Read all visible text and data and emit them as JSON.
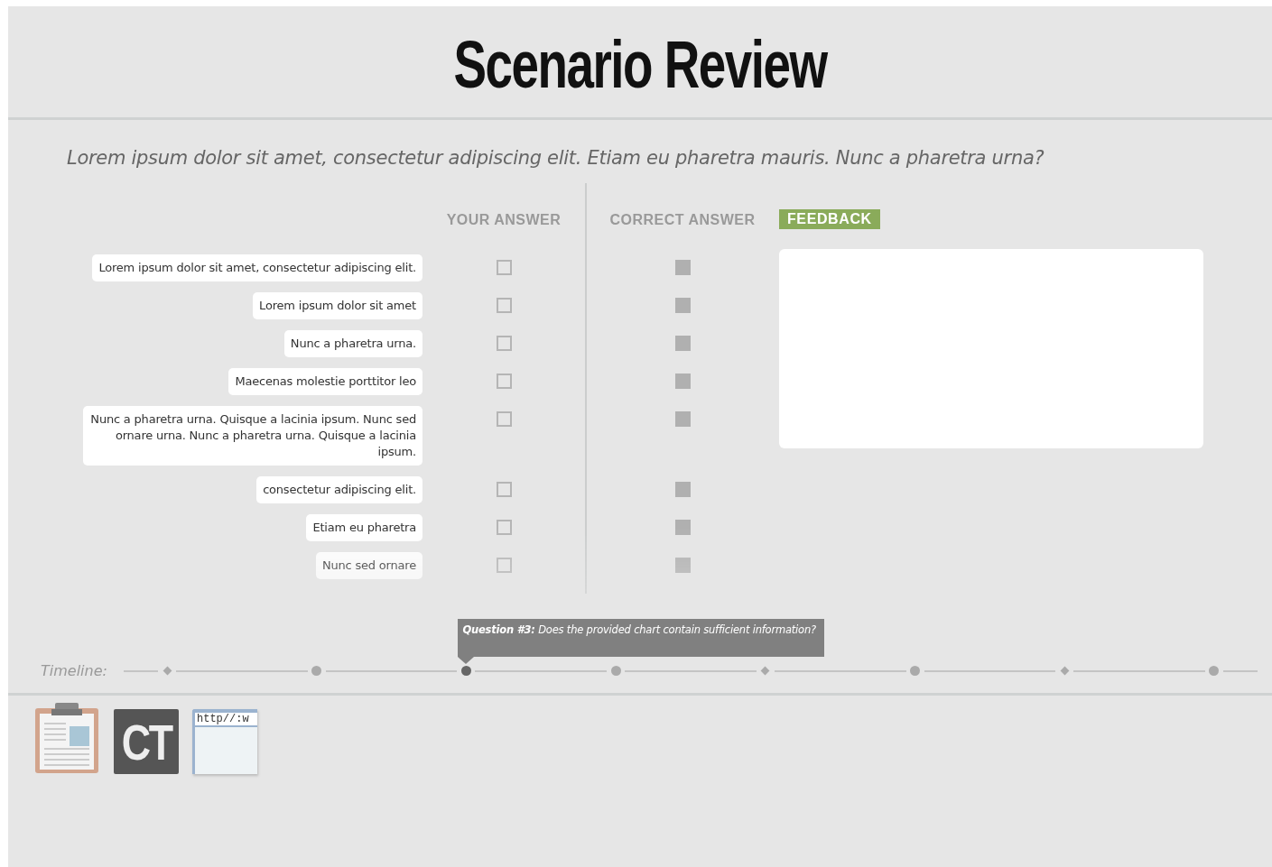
{
  "title": "Scenario Review",
  "question": "Lorem ipsum dolor sit amet, consectetur adipiscing elit. Etiam eu pharetra mauris. Nunc a pharetra urna?",
  "columns": {
    "your_answer": "YOUR ANSWER",
    "correct_answer": "CORRECT ANSWER",
    "feedback": "FEEDBACK"
  },
  "rows": [
    {
      "text": "Lorem ipsum dolor sit amet, consectetur adipiscing elit.",
      "your_checked": false,
      "correct_checked": true
    },
    {
      "text": "Lorem ipsum dolor sit amet",
      "your_checked": false,
      "correct_checked": true
    },
    {
      "text": "Nunc a pharetra urna.",
      "your_checked": false,
      "correct_checked": true
    },
    {
      "text": "Maecenas molestie porttitor leo",
      "your_checked": false,
      "correct_checked": true
    },
    {
      "text": "Nunc a pharetra urna. Quisque a lacinia ipsum. Nunc sed ornare urna. Nunc a pharetra urna. Quisque a lacinia ipsum.",
      "your_checked": false,
      "correct_checked": true
    },
    {
      "text": "consectetur adipiscing elit.",
      "your_checked": false,
      "correct_checked": true
    },
    {
      "text": "Etiam eu pharetra",
      "your_checked": false,
      "correct_checked": true
    },
    {
      "text": "Nunc sed ornare",
      "your_checked": false,
      "correct_checked": true
    }
  ],
  "timeline": {
    "label": "Timeline:",
    "tooltip": "**Question #3:** Does the provided chart contain sufficient information?",
    "markers": [
      {
        "kind": "diamond",
        "selected": false
      },
      {
        "kind": "dot",
        "selected": false
      },
      {
        "kind": "dot",
        "selected": true
      },
      {
        "kind": "dot",
        "selected": false
      },
      {
        "kind": "diamond",
        "selected": false
      },
      {
        "kind": "dot",
        "selected": false
      },
      {
        "kind": "diamond",
        "selected": false
      },
      {
        "kind": "dot",
        "selected": false
      }
    ]
  },
  "tools": [
    {
      "kind": "clipboard"
    },
    {
      "kind": "logo",
      "text": "CT"
    },
    {
      "kind": "browser",
      "text": "http//:w"
    }
  ]
}
